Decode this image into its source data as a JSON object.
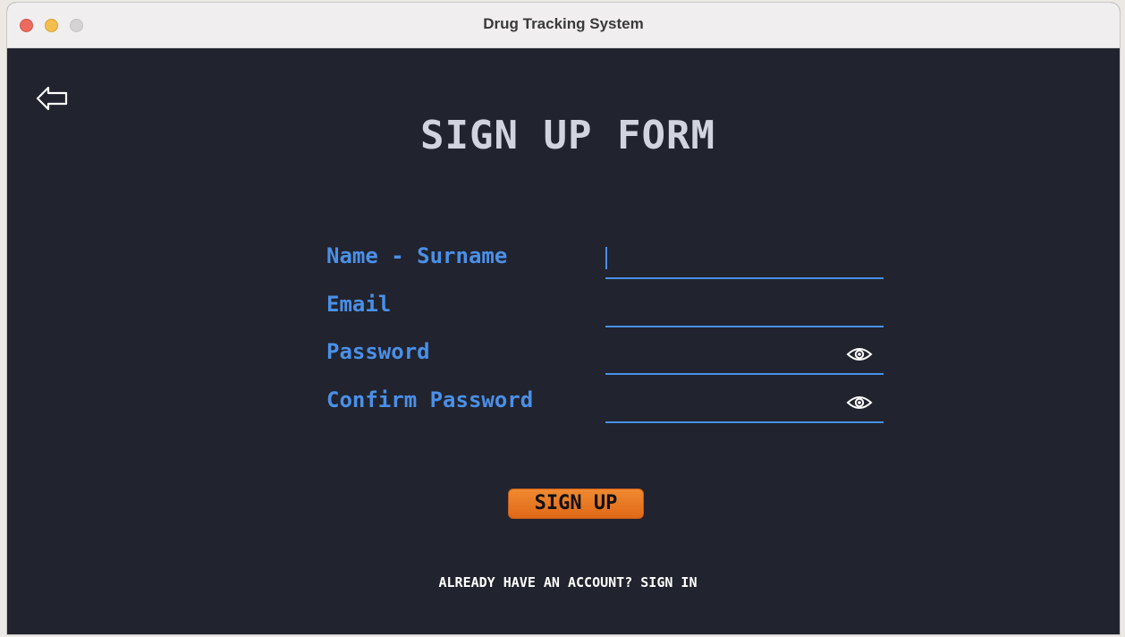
{
  "window": {
    "title": "Drug Tracking System"
  },
  "form": {
    "heading": "SIGN UP FORM",
    "fields": [
      {
        "label": "Name - Surname",
        "value": "",
        "icon": null
      },
      {
        "label": "Email",
        "value": "",
        "icon": null
      },
      {
        "label": "Password",
        "value": "",
        "icon": "eye-icon"
      },
      {
        "label": "Confirm Password",
        "value": "",
        "icon": "eye-icon"
      }
    ],
    "submit_label": "SIGN UP",
    "signin_link": "ALREADY HAVE AN ACCOUNT? SIGN IN"
  },
  "colors": {
    "background": "#21232e",
    "accent": "#4a90e8",
    "button": "#e87a25",
    "heading": "#d1d4df"
  }
}
